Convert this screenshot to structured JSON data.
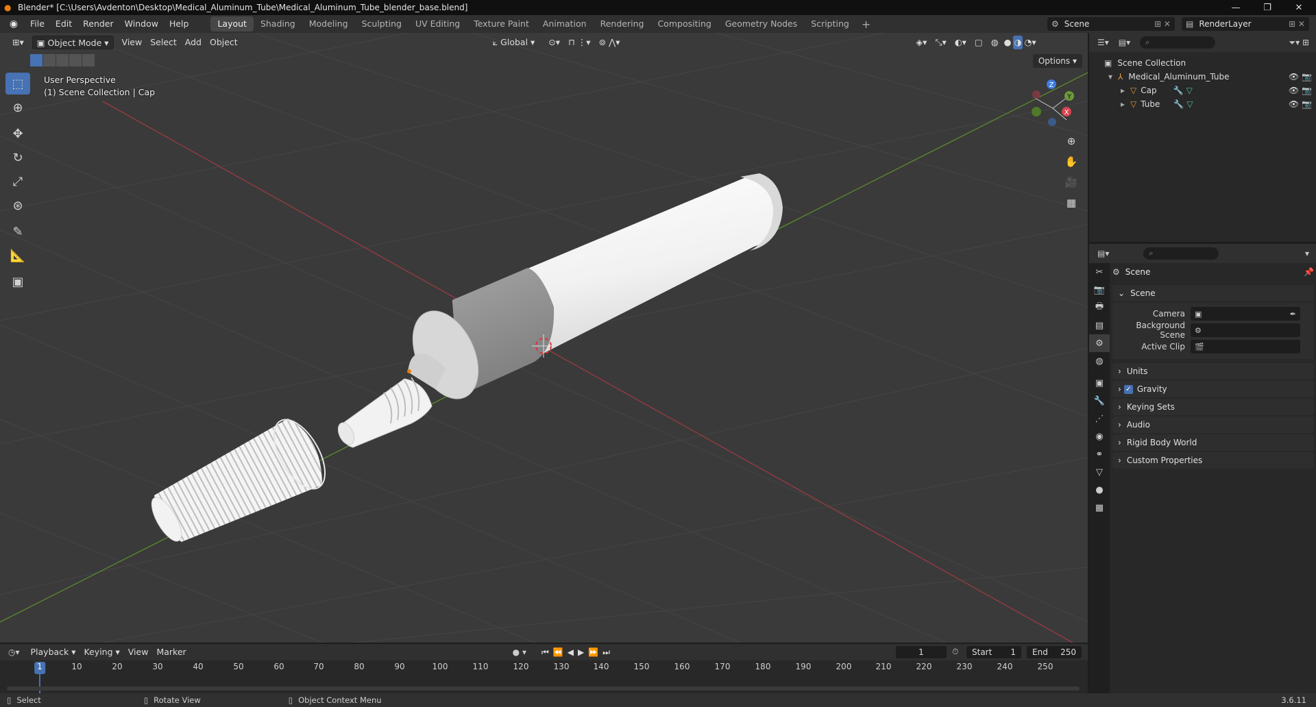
{
  "titlebar": {
    "title": "Blender* [C:\\Users\\Avdenton\\Desktop\\Medical_Aluminum_Tube\\Medical_Aluminum_Tube_blender_base.blend]"
  },
  "menu": {
    "items": [
      "File",
      "Edit",
      "Render",
      "Window",
      "Help"
    ]
  },
  "workspaces": {
    "tabs": [
      "Layout",
      "Shading",
      "Modeling",
      "Sculpting",
      "UV Editing",
      "Texture Paint",
      "Animation",
      "Rendering",
      "Compositing",
      "Geometry Nodes",
      "Scripting"
    ],
    "active": "Layout"
  },
  "scene_selector": {
    "scene": "Scene",
    "view_layer": "RenderLayer"
  },
  "viewport": {
    "mode": "Object Mode",
    "menus": [
      "View",
      "Select",
      "Add",
      "Object"
    ],
    "orientation": "Global",
    "perspective_label": "User Perspective",
    "context_label": "(1) Scene Collection | Cap",
    "options_label": "Options",
    "gizmo": {
      "x": "X",
      "y": "Y",
      "z": "Z"
    }
  },
  "outliner": {
    "root": "Scene Collection",
    "collection": "Medical_Aluminum_Tube",
    "objects": [
      "Cap",
      "Tube"
    ]
  },
  "properties": {
    "context": "Scene",
    "section": "Scene",
    "rows": [
      {
        "label": "Camera",
        "value": ""
      },
      {
        "label": "Background Scene",
        "value": ""
      },
      {
        "label": "Active Clip",
        "value": ""
      }
    ],
    "subsections": [
      "Units",
      "Gravity",
      "Keying Sets",
      "Audio",
      "Rigid Body World",
      "Custom Properties"
    ]
  },
  "timeline": {
    "menus": [
      "Playback",
      "Keying",
      "View",
      "Marker"
    ],
    "current_frame": "1",
    "start_label": "Start",
    "start": "1",
    "end_label": "End",
    "end": "250",
    "ruler": [
      "1",
      "10",
      "20",
      "30",
      "40",
      "50",
      "60",
      "70",
      "80",
      "90",
      "100",
      "110",
      "120",
      "130",
      "140",
      "150",
      "160",
      "170",
      "180",
      "190",
      "200",
      "210",
      "220",
      "230",
      "240",
      "250"
    ]
  },
  "statusbar": {
    "select": "Select",
    "rotate": "Rotate View",
    "context_menu": "Object Context Menu",
    "version": "3.6.11"
  },
  "colors": {
    "accent": "#4772b3",
    "x_axis": "#c0404a",
    "y_axis": "#6a9a3a",
    "z_axis": "#3d7ce0",
    "object_orange": "#e87d0d"
  }
}
